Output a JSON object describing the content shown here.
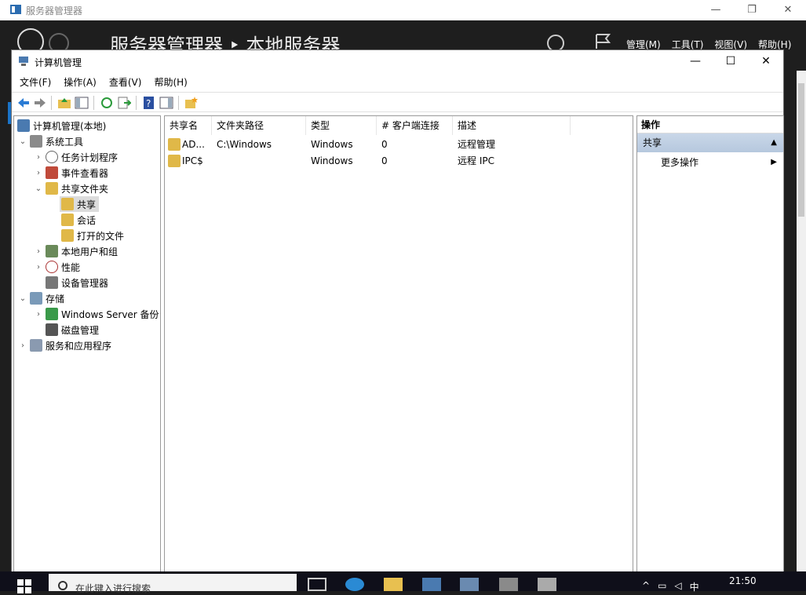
{
  "server_manager": {
    "title": "服务器管理器",
    "breadcrumb": "服务器管理器 ‣ 本地服务器",
    "menus": [
      "管理(M)",
      "工具(T)",
      "视图(V)",
      "帮助(H)"
    ]
  },
  "window": {
    "title": "计算机管理",
    "menu": [
      "文件(F)",
      "操作(A)",
      "查看(V)",
      "帮助(H)"
    ]
  },
  "tree": {
    "root": "计算机管理(本地)",
    "system_tools": "系统工具",
    "task_scheduler": "任务计划程序",
    "event_viewer": "事件查看器",
    "shared_folders": "共享文件夹",
    "shares": "共享",
    "sessions": "会话",
    "open_files": "打开的文件",
    "local_users": "本地用户和组",
    "performance": "性能",
    "device_manager": "设备管理器",
    "storage": "存储",
    "wsb": "Windows Server 备份",
    "disk_mgmt": "磁盘管理",
    "services_apps": "服务和应用程序"
  },
  "list": {
    "headers": [
      "共享名",
      "文件夹路径",
      "类型",
      "# 客户端连接",
      "描述"
    ],
    "rows": [
      {
        "name": "AD...",
        "path": "C:\\Windows",
        "type": "Windows",
        "clients": "0",
        "desc": "远程管理"
      },
      {
        "name": "IPC$",
        "path": "",
        "type": "Windows",
        "clients": "0",
        "desc": "远程 IPC"
      }
    ]
  },
  "actions": {
    "header": "操作",
    "section": "共享",
    "more": "更多操作"
  },
  "taskbar": {
    "search_placeholder": "在此键入进行搜索",
    "time": "21:50",
    "ime": "中"
  },
  "colors": {
    "accent": "#1a73c8",
    "selection": "#dcdcdc"
  }
}
